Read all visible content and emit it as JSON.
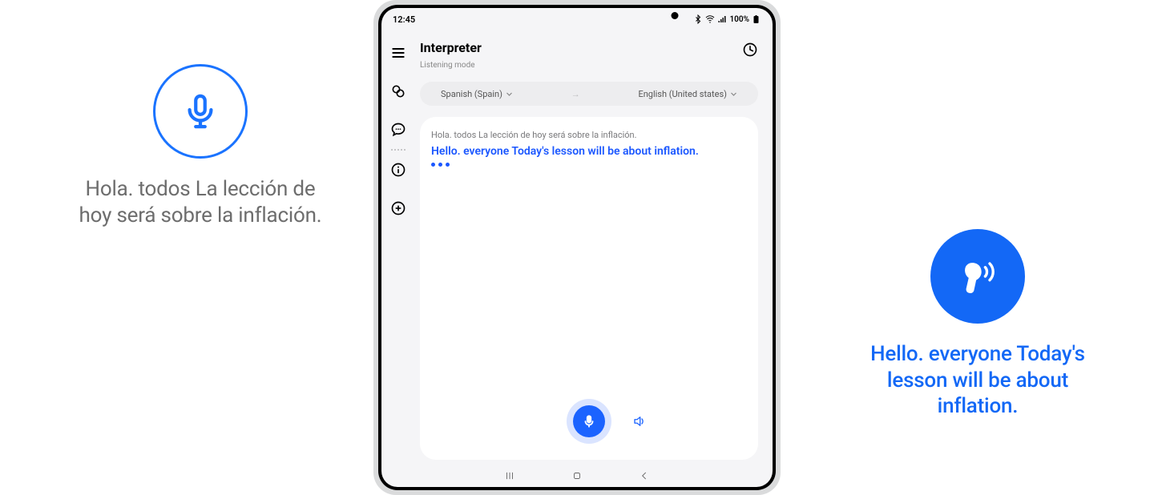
{
  "left_callout": {
    "text": "Hola. todos La lección de hoy será sobre la inflación."
  },
  "right_callout": {
    "text": "Hello. everyone Today's lesson will be about inflation."
  },
  "statusbar": {
    "time": "12:45",
    "battery": "100%"
  },
  "header": {
    "title": "Interpreter",
    "subtitle": "Listening mode"
  },
  "languages": {
    "source": "Spanish (Spain)",
    "target": "English (United states)"
  },
  "conversation": {
    "source_text": "Hola. todos La lección de hoy será sobre la inflación.",
    "target_text": "Hello. everyone Today's lesson will be about inflation."
  }
}
